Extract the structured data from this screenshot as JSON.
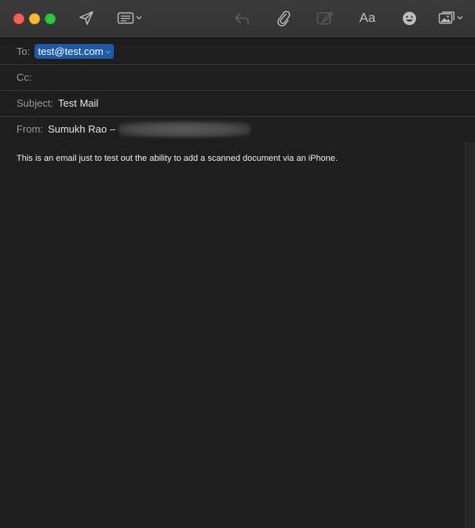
{
  "compose": {
    "to_label": "To:",
    "to_recipient": "test@test.com",
    "cc_label": "Cc:",
    "cc_value": "",
    "subject_label": "Subject:",
    "subject_value": "Test Mail",
    "from_label": "From:",
    "from_value": "Sumukh Rao –",
    "body_text": "This is an email just to test out the ability to add a scanned document via an iPhone."
  },
  "toolbar": {
    "format_label": "Aa",
    "icons": [
      "send-icon",
      "header-fields-icon",
      "reply-icon",
      "attachment-icon",
      "markup-icon",
      "format-icon",
      "emoji-icon",
      "photo-browser-icon"
    ]
  },
  "colors": {
    "background": "#1e1e1e",
    "toolbar": "#363636",
    "token": "#1f5aa6",
    "close": "#fe5f57",
    "minimize": "#febc2e",
    "maximize": "#28c840"
  }
}
